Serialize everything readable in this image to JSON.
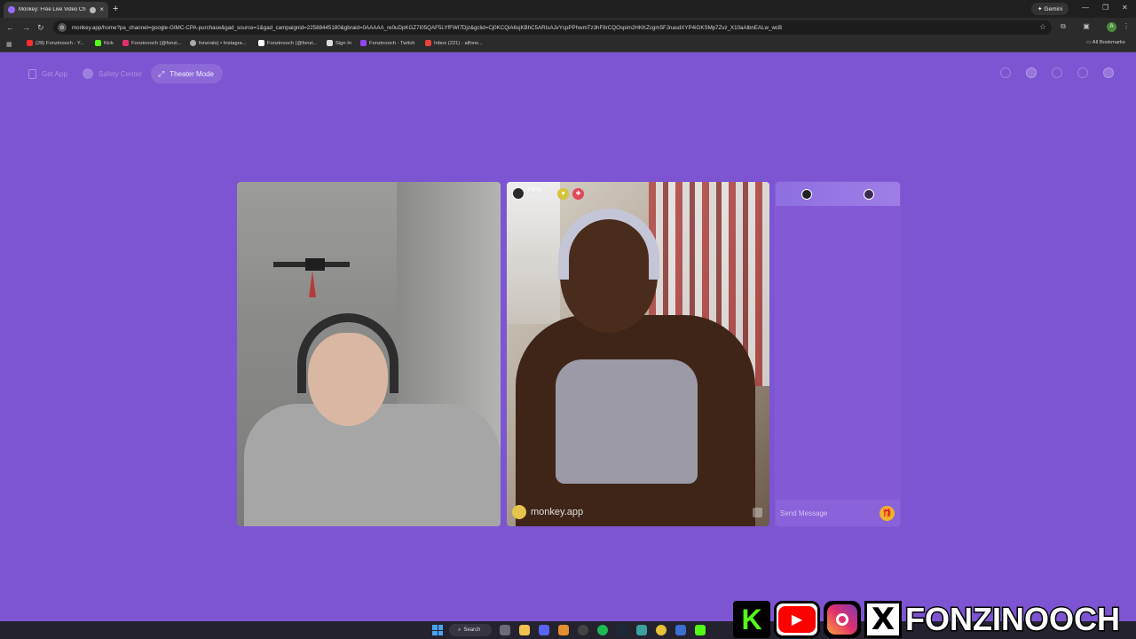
{
  "browser": {
    "tab_title": "Monkey: Free Live Video Ch",
    "new_tab_icon": "plus-icon",
    "gemini_label": "Gemini",
    "url": "monkey.app/home?pa_channel=google-GIMC-CPA-purchase&gad_source=1&gad_campaignid=22588445180&gbraid=0AAAAA_re0uDpKGZ7I05QAF5LYfFWI7Djz&gclid=Cj0KCQiA6sjKBhC5ARIsAJvYcpPPhwmTz3hF8rCQOspim2HKKZcgm5FJnasdXYP4iGKSMp7Zvz_X10aAlbnEALw_wcB",
    "bookmarks": [
      {
        "label": "(28) Fonzinooch - Y...",
        "color": "#ff2d2d"
      },
      {
        "label": "Kick",
        "color": "#53fc18"
      },
      {
        "label": "Fonzinooch (@fonzi...",
        "color": "#e1306c"
      },
      {
        "label": "fonzrats) • Instagra...",
        "color": "#aaaaaa"
      },
      {
        "label": "Fonzinooch (@fonzi...",
        "color": "#ffffff"
      },
      {
        "label": "Sign In",
        "color": "#dddddd"
      },
      {
        "label": "Fonzinooch - Twitch",
        "color": "#9146ff"
      },
      {
        "label": "Inbox (221) - alfons...",
        "color": "#ea4335"
      }
    ],
    "all_bookmarks": "All Bookmarks",
    "profile_initial": "A"
  },
  "page": {
    "nav": {
      "get_app": "Get App",
      "safety_center": "Safety Center",
      "theater_mode": "Theater Mode"
    },
    "remote_user": {
      "name": "Fat'at",
      "subtitle": "North Carolina"
    },
    "watermark": "monkey.app",
    "chat": {
      "placeholder": "Send Message"
    }
  },
  "taskbar": {
    "search_label": "Search"
  },
  "overlay": {
    "kick_letter": "K",
    "x_letter": "X",
    "handle": "FONZINOOCH"
  },
  "colors": {
    "brand_purple": "#7d55d2",
    "gift_gold": "#f2b12c"
  }
}
